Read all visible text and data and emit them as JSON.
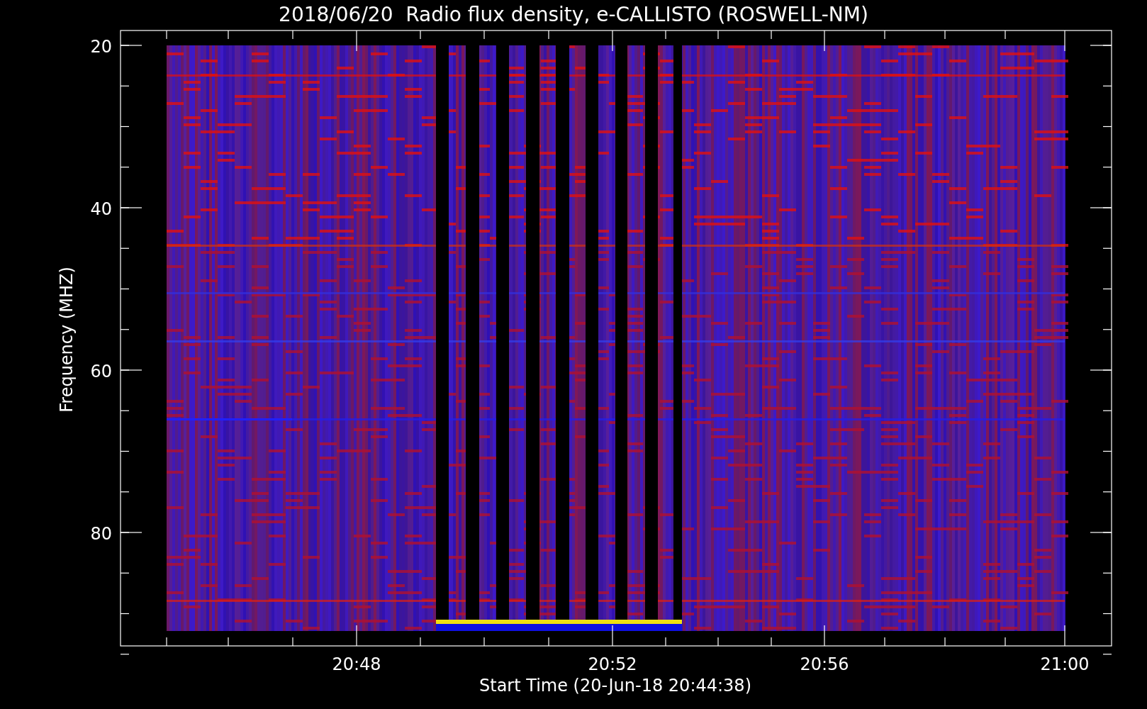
{
  "title": "2018/06/20  Radio flux density, e-CALLISTO (ROSWELL-NM)",
  "y_axis": {
    "label": "Frequency (MHZ)",
    "ticks": [
      "20",
      "40",
      "60",
      "80"
    ]
  },
  "x_axis": {
    "label": "Start Time (20-Jun-18 20:44:38)",
    "ticks": [
      "20:48",
      "20:52",
      "20:56",
      "21:00"
    ]
  }
}
